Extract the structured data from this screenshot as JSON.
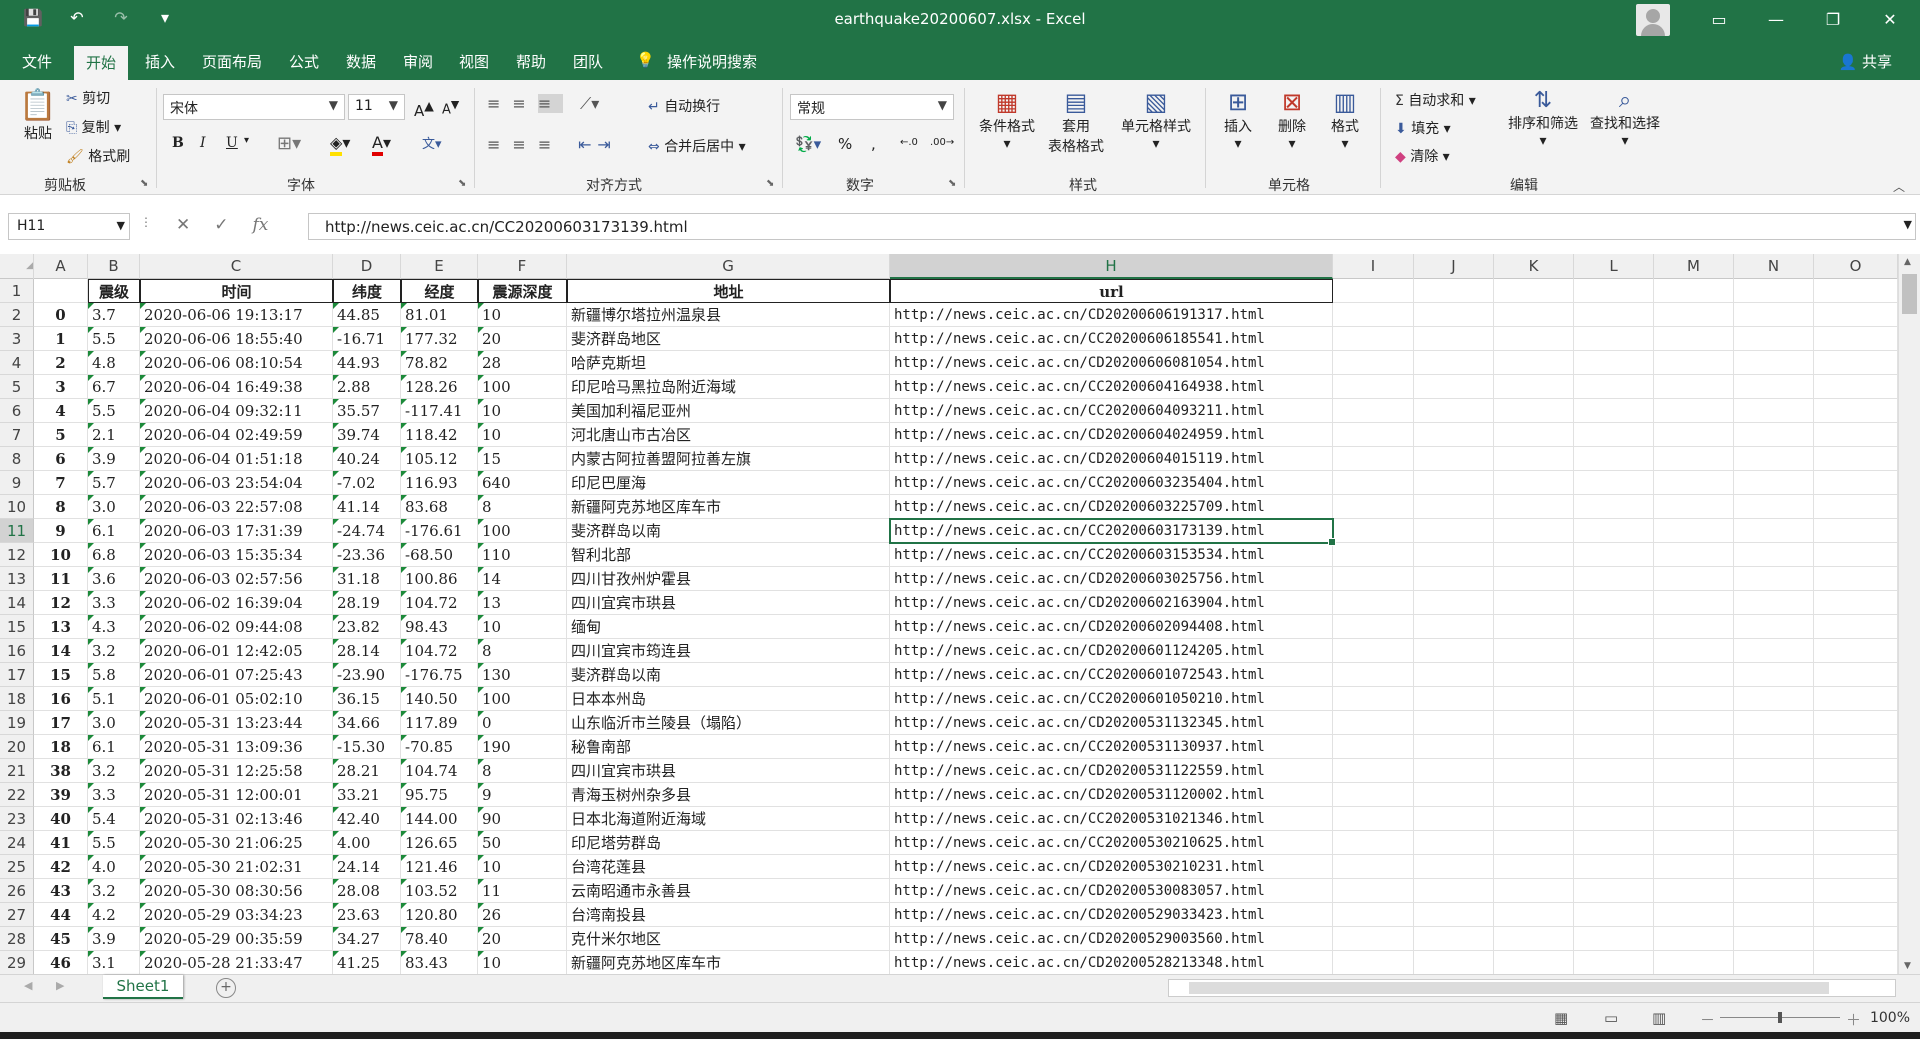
{
  "window": {
    "title": "earthquake20200607.xlsx  -  Excel",
    "controls": {
      "ribbon_display": "▭",
      "minimize": "—",
      "restore": "❐",
      "close": "✕"
    }
  },
  "quick_access": [
    "save-icon",
    "undo-icon",
    "redo-icon",
    "customize-icon"
  ],
  "tabs": [
    "文件",
    "开始",
    "插入",
    "页面布局",
    "公式",
    "数据",
    "审阅",
    "视图",
    "帮助",
    "团队",
    "操作说明搜索"
  ],
  "share_label": "共享",
  "ribbon": {
    "clipboard": {
      "paste": "粘贴",
      "cut": "剪切",
      "copy": "复制",
      "format_painter": "格式刷",
      "group": "剪贴板"
    },
    "font": {
      "name": "宋体",
      "size": "11",
      "bold": "B",
      "italic": "I",
      "underline": "U",
      "group": "字体"
    },
    "alignment": {
      "wrap": "自动换行",
      "merge": "合并后居中",
      "group": "对齐方式"
    },
    "number": {
      "format": "常规",
      "group": "数字"
    },
    "styles": {
      "conditional": "条件格式",
      "table_1": "套用",
      "table_2": "表格格式",
      "cell_styles": "单元格样式",
      "group": "样式"
    },
    "cells": {
      "insert": "插入",
      "delete": "删除",
      "format": "格式",
      "group": "单元格"
    },
    "editing": {
      "autosum": "自动求和",
      "fill": "填充",
      "clear": "清除",
      "sort": "排序和筛选",
      "find": "查找和选择",
      "group": "编辑"
    }
  },
  "formula_bar": {
    "name_box": "H11",
    "fx": "fx",
    "content": "http://news.ceic.ac.cn/CC20200603173139.html"
  },
  "columns": [
    "A",
    "B",
    "C",
    "D",
    "E",
    "F",
    "G",
    "H",
    "I",
    "J",
    "K",
    "L",
    "M",
    "N",
    "O"
  ],
  "selected": {
    "column": "H",
    "row": "11"
  },
  "headers": [
    "震级",
    "时间",
    "纬度",
    "经度",
    "震源深度",
    "地址",
    "url"
  ],
  "rows": [
    [
      "0",
      "3.7",
      "2020-06-06 19:13:17",
      "44.85",
      "81.01",
      "10",
      "新疆博尔塔拉州温泉县",
      "http://news.ceic.ac.cn/CD20200606191317.html"
    ],
    [
      "1",
      "5.5",
      "2020-06-06 18:55:40",
      "-16.71",
      "177.32",
      "20",
      "斐济群岛地区",
      "http://news.ceic.ac.cn/CC20200606185541.html"
    ],
    [
      "2",
      "4.8",
      "2020-06-06 08:10:54",
      "44.93",
      "78.82",
      "28",
      "哈萨克斯坦",
      "http://news.ceic.ac.cn/CD20200606081054.html"
    ],
    [
      "3",
      "6.7",
      "2020-06-04 16:49:38",
      "2.88",
      "128.26",
      "100",
      "印尼哈马黑拉岛附近海域",
      "http://news.ceic.ac.cn/CC20200604164938.html"
    ],
    [
      "4",
      "5.5",
      "2020-06-04 09:32:11",
      "35.57",
      "-117.41",
      "10",
      "美国加利福尼亚州",
      "http://news.ceic.ac.cn/CC20200604093211.html"
    ],
    [
      "5",
      "2.1",
      "2020-06-04 02:49:59",
      "39.74",
      "118.42",
      "10",
      "河北唐山市古冶区",
      "http://news.ceic.ac.cn/CD20200604024959.html"
    ],
    [
      "6",
      "3.9",
      "2020-06-04 01:51:18",
      "40.24",
      "105.12",
      "15",
      "内蒙古阿拉善盟阿拉善左旗",
      "http://news.ceic.ac.cn/CD20200604015119.html"
    ],
    [
      "7",
      "5.7",
      "2020-06-03 23:54:04",
      "-7.02",
      "116.93",
      "640",
      "印尼巴厘海",
      "http://news.ceic.ac.cn/CC20200603235404.html"
    ],
    [
      "8",
      "3.0",
      "2020-06-03 22:57:08",
      "41.14",
      "83.68",
      "8",
      "新疆阿克苏地区库车市",
      "http://news.ceic.ac.cn/CD20200603225709.html"
    ],
    [
      "9",
      "6.1",
      "2020-06-03 17:31:39",
      "-24.74",
      "-176.61",
      "100",
      "斐济群岛以南",
      "http://news.ceic.ac.cn/CC20200603173139.html"
    ],
    [
      "10",
      "6.8",
      "2020-06-03 15:35:34",
      "-23.36",
      "-68.50",
      "110",
      "智利北部",
      "http://news.ceic.ac.cn/CC20200603153534.html"
    ],
    [
      "11",
      "3.6",
      "2020-06-03 02:57:56",
      "31.18",
      "100.86",
      "14",
      "四川甘孜州炉霍县",
      "http://news.ceic.ac.cn/CD20200603025756.html"
    ],
    [
      "12",
      "3.3",
      "2020-06-02 16:39:04",
      "28.19",
      "104.72",
      "13",
      "四川宜宾市珙县",
      "http://news.ceic.ac.cn/CD20200602163904.html"
    ],
    [
      "13",
      "4.3",
      "2020-06-02 09:44:08",
      "23.82",
      "98.43",
      "10",
      "缅甸",
      "http://news.ceic.ac.cn/CD20200602094408.html"
    ],
    [
      "14",
      "3.2",
      "2020-06-01 12:42:05",
      "28.14",
      "104.72",
      "8",
      "四川宜宾市筠连县",
      "http://news.ceic.ac.cn/CD20200601124205.html"
    ],
    [
      "15",
      "5.8",
      "2020-06-01 07:25:43",
      "-23.90",
      "-176.75",
      "130",
      "斐济群岛以南",
      "http://news.ceic.ac.cn/CC20200601072543.html"
    ],
    [
      "16",
      "5.1",
      "2020-06-01 05:02:10",
      "36.15",
      "140.50",
      "100",
      "日本本州岛",
      "http://news.ceic.ac.cn/CC20200601050210.html"
    ],
    [
      "17",
      "3.0",
      "2020-05-31 13:23:44",
      "34.66",
      "117.89",
      "0",
      "山东临沂市兰陵县（塌陷）",
      "http://news.ceic.ac.cn/CD20200531132345.html"
    ],
    [
      "18",
      "6.1",
      "2020-05-31 13:09:36",
      "-15.30",
      "-70.85",
      "190",
      "秘鲁南部",
      "http://news.ceic.ac.cn/CC20200531130937.html"
    ],
    [
      "38",
      "3.2",
      "2020-05-31 12:25:58",
      "28.21",
      "104.74",
      "8",
      "四川宜宾市珙县",
      "http://news.ceic.ac.cn/CD20200531122559.html"
    ],
    [
      "39",
      "3.3",
      "2020-05-31 12:00:01",
      "33.21",
      "95.75",
      "9",
      "青海玉树州杂多县",
      "http://news.ceic.ac.cn/CD20200531120002.html"
    ],
    [
      "40",
      "5.4",
      "2020-05-31 02:13:46",
      "42.40",
      "144.00",
      "90",
      "日本北海道附近海域",
      "http://news.ceic.ac.cn/CC20200531021346.html"
    ],
    [
      "41",
      "5.5",
      "2020-05-30 21:06:25",
      "4.00",
      "126.65",
      "50",
      "印尼塔劳群岛",
      "http://news.ceic.ac.cn/CC20200530210625.html"
    ],
    [
      "42",
      "4.0",
      "2020-05-30 21:02:31",
      "24.14",
      "121.46",
      "10",
      "台湾花莲县",
      "http://news.ceic.ac.cn/CD20200530210231.html"
    ],
    [
      "43",
      "3.2",
      "2020-05-30 08:30:56",
      "28.08",
      "103.52",
      "11",
      "云南昭通市永善县",
      "http://news.ceic.ac.cn/CD20200530083057.html"
    ],
    [
      "44",
      "4.2",
      "2020-05-29 03:34:23",
      "23.63",
      "120.80",
      "26",
      "台湾南投县",
      "http://news.ceic.ac.cn/CD20200529033423.html"
    ],
    [
      "45",
      "3.9",
      "2020-05-29 00:35:59",
      "34.27",
      "78.40",
      "20",
      "克什米尔地区",
      "http://news.ceic.ac.cn/CD20200529003560.html"
    ],
    [
      "46",
      "3.1",
      "2020-05-28 21:33:47",
      "41.25",
      "83.43",
      "10",
      "新疆阿克苏地区库车市",
      "http://news.ceic.ac.cn/CD20200528213348.html"
    ]
  ],
  "sheet_tab": "Sheet1",
  "add_sheet": "+",
  "zoom": "100%",
  "colors": {
    "accent": "#217346",
    "ribbon_bg": "#f3f3f3",
    "grid_line": "#e1e1e1"
  }
}
